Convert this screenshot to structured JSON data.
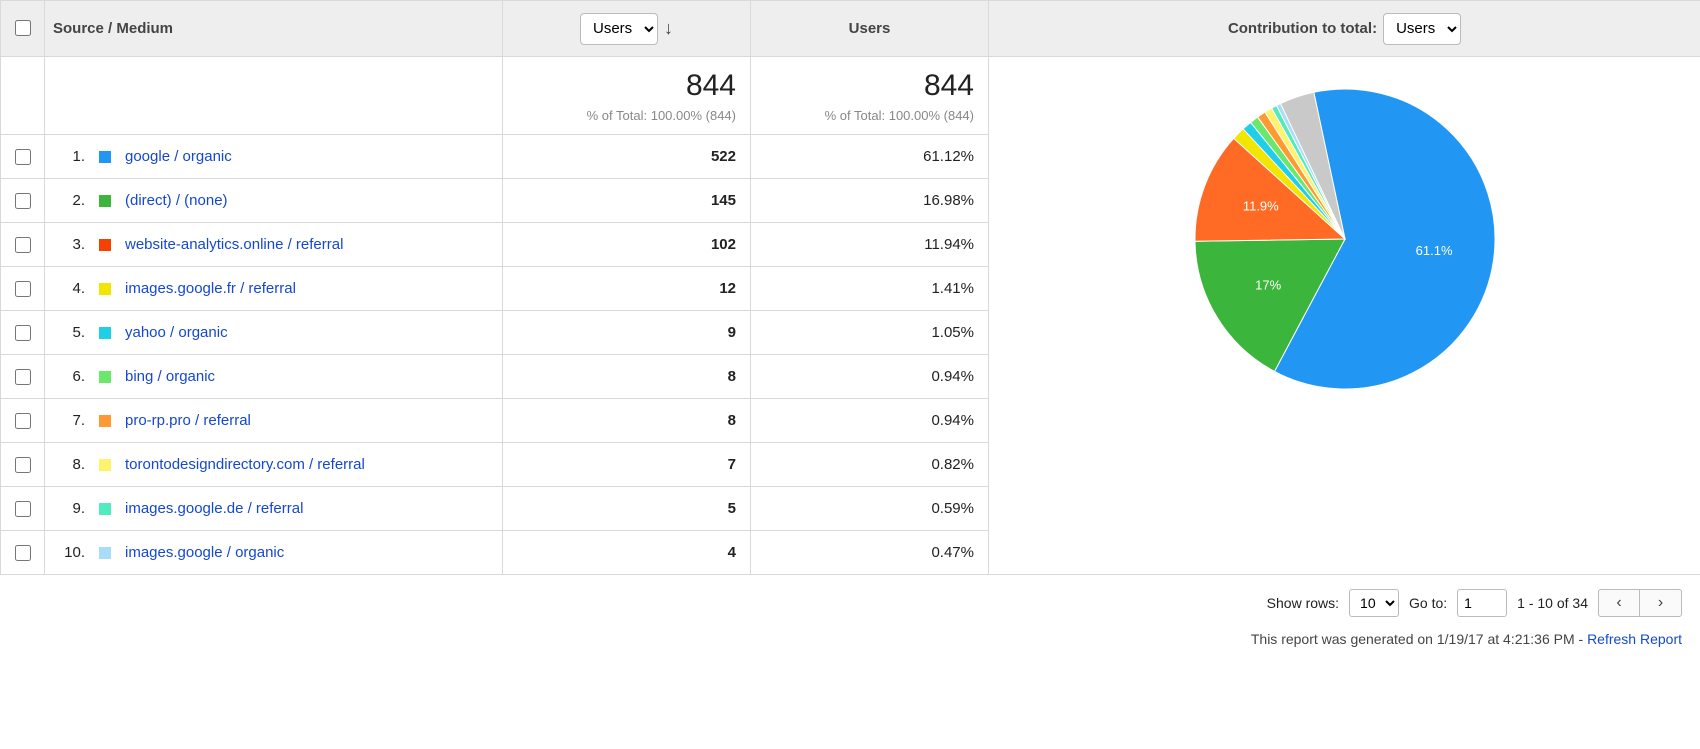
{
  "header": {
    "dim_label": "Source / Medium",
    "metric_select_1": "Users",
    "metric_col_2": "Users",
    "contrib_label": "Contribution to total:",
    "contrib_select": "Users"
  },
  "totals": {
    "users1": "844",
    "users1_sub": "% of Total: 100.00% (844)",
    "users2": "844",
    "users2_sub": "% of Total: 100.00% (844)"
  },
  "rows": [
    {
      "rank": "1.",
      "swatch": "#2196f3",
      "name": "google / organic",
      "users": "522",
      "pct": "61.12%"
    },
    {
      "rank": "2.",
      "swatch": "#3bb53b",
      "name": "(direct) / (none)",
      "users": "145",
      "pct": "16.98%"
    },
    {
      "rank": "3.",
      "swatch": "#f44200",
      "name": "website-analytics.online / referral",
      "users": "102",
      "pct": "11.94%"
    },
    {
      "rank": "4.",
      "swatch": "#f2e500",
      "name": "images.google.fr / referral",
      "users": "12",
      "pct": "1.41%"
    },
    {
      "rank": "5.",
      "swatch": "#1fcfe7",
      "name": "yahoo / organic",
      "users": "9",
      "pct": "1.05%"
    },
    {
      "rank": "6.",
      "swatch": "#6be86b",
      "name": "bing / organic",
      "users": "8",
      "pct": "0.94%"
    },
    {
      "rank": "7.",
      "swatch": "#ff9933",
      "name": "pro-rp.pro / referral",
      "users": "8",
      "pct": "0.94%"
    },
    {
      "rank": "8.",
      "swatch": "#fff36b",
      "name": "torontodesigndirectory.com / referral",
      "users": "7",
      "pct": "0.82%"
    },
    {
      "rank": "9.",
      "swatch": "#52ebc0",
      "name": "images.google.de / referral",
      "users": "5",
      "pct": "0.59%"
    },
    {
      "rank": "10.",
      "swatch": "#a9ddf7",
      "name": "images.google / organic",
      "users": "4",
      "pct": "0.47%"
    }
  ],
  "footer": {
    "show_rows_label": "Show rows:",
    "show_rows_value": "10",
    "goto_label": "Go to:",
    "goto_value": "1",
    "range": "1 - 10 of 34"
  },
  "meta": {
    "generated": "This report was generated on 1/19/17 at 4:21:36 PM - ",
    "refresh": "Refresh Report"
  },
  "chart_data": {
    "type": "pie",
    "title": "Contribution to total: Users",
    "slices": [
      {
        "name": "google / organic",
        "value": 61.12,
        "color": "#2196f3",
        "label": "61.1%"
      },
      {
        "name": "(direct) / (none)",
        "value": 16.98,
        "color": "#3bb53b",
        "label": "17%"
      },
      {
        "name": "website-analytics.online / referral",
        "value": 11.94,
        "color": "#ff6a24",
        "label": "11.9%"
      },
      {
        "name": "images.google.fr / referral",
        "value": 1.41,
        "color": "#f2e500"
      },
      {
        "name": "yahoo / organic",
        "value": 1.05,
        "color": "#1fcfe7"
      },
      {
        "name": "bing / organic",
        "value": 0.94,
        "color": "#6be86b"
      },
      {
        "name": "pro-rp.pro / referral",
        "value": 0.94,
        "color": "#ff9933"
      },
      {
        "name": "torontodesigndirectory.com / referral",
        "value": 0.82,
        "color": "#fff36b"
      },
      {
        "name": "images.google.de / referral",
        "value": 0.59,
        "color": "#52ebc0"
      },
      {
        "name": "images.google / organic",
        "value": 0.47,
        "color": "#a9ddf7"
      },
      {
        "name": "other",
        "value": 3.74,
        "color": "#c9c9c9"
      }
    ]
  }
}
